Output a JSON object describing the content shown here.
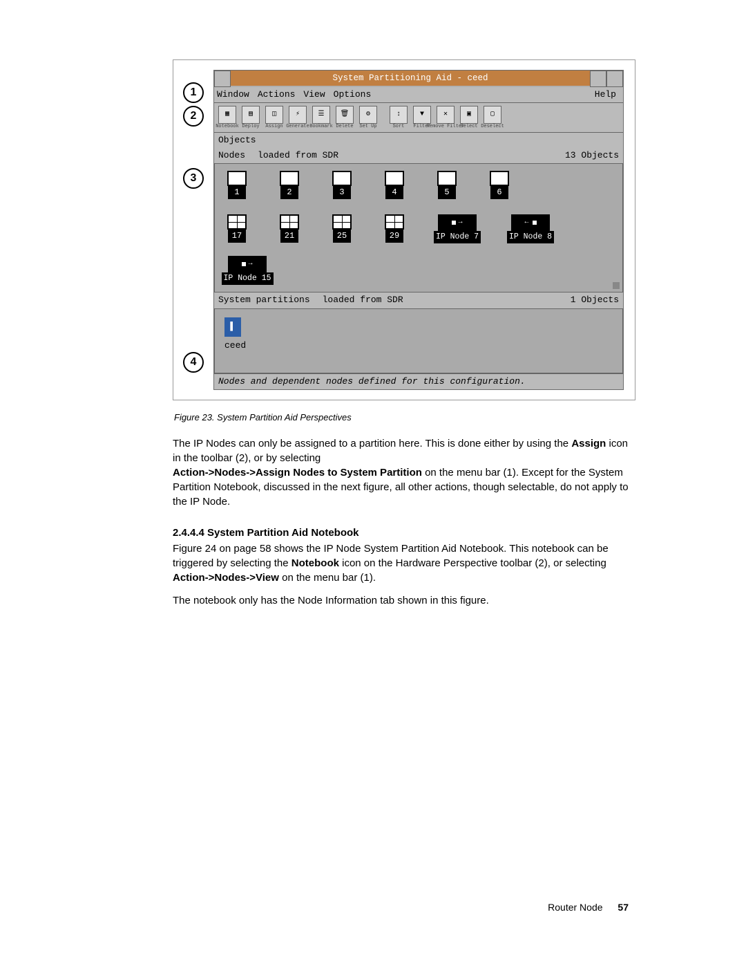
{
  "callouts": {
    "c1": "1",
    "c2": "2",
    "c3": "3",
    "c4": "4"
  },
  "app": {
    "title": "System Partitioning Aid - ceed",
    "menu": {
      "window": "Window",
      "actions": "Actions",
      "view": "View",
      "options": "Options",
      "help": "Help"
    },
    "objects_label": "Objects",
    "nodes_hdr": {
      "left": "Nodes",
      "mid": "loaded from SDR",
      "right": "13 Objects"
    },
    "nodes_row1": [
      "1",
      "2",
      "3",
      "4",
      "5",
      "6"
    ],
    "nodes_row2": [
      "17",
      "21",
      "25",
      "29"
    ],
    "ip7": "IP Node 7",
    "ip8": "IP Node 8",
    "ip15": "IP Node 15",
    "parts_hdr": {
      "left": "System partitions",
      "mid": "loaded from SDR",
      "right": "1 Objects"
    },
    "part_name": "ceed",
    "status": "Nodes and dependent nodes defined for this configuration."
  },
  "toolbar_items": [
    "Notebook",
    "Deploy",
    "Assign",
    "Generate",
    "Bookmark",
    "Delete",
    "Set Up",
    "Sort",
    "Filter",
    "Remove Filter",
    "Select",
    "Deselect"
  ],
  "caption": "Figure 23.  System Partition Aid Perspectives",
  "para1a": "The IP Nodes can only be assigned to a partition here. This is done either by using the ",
  "para1b": "Assign",
  "para1c": " icon in the toolbar (2), or by selecting",
  "para2a": "Action->Nodes->Assign Nodes to System Partition",
  "para2b": " on the menu bar (1). Except for the System Partition Notebook, discussed in the next figure, all other actions, though selectable, do not apply to the IP Node.",
  "section_head": "2.4.4.4  System Partition Aid Notebook",
  "para3a": "Figure 24 on page 58 shows the IP Node System Partition Aid Notebook. This notebook can be triggered by selecting the ",
  "para3b": "Notebook",
  "para3c": " icon on the Hardware Perspective toolbar (2), or selecting ",
  "para3d": "Action->Nodes->View",
  "para3e": " on the menu bar (1).",
  "para4": "The notebook only has the Node Information tab shown in this figure.",
  "footer_label": "Router Node",
  "footer_page": "57"
}
